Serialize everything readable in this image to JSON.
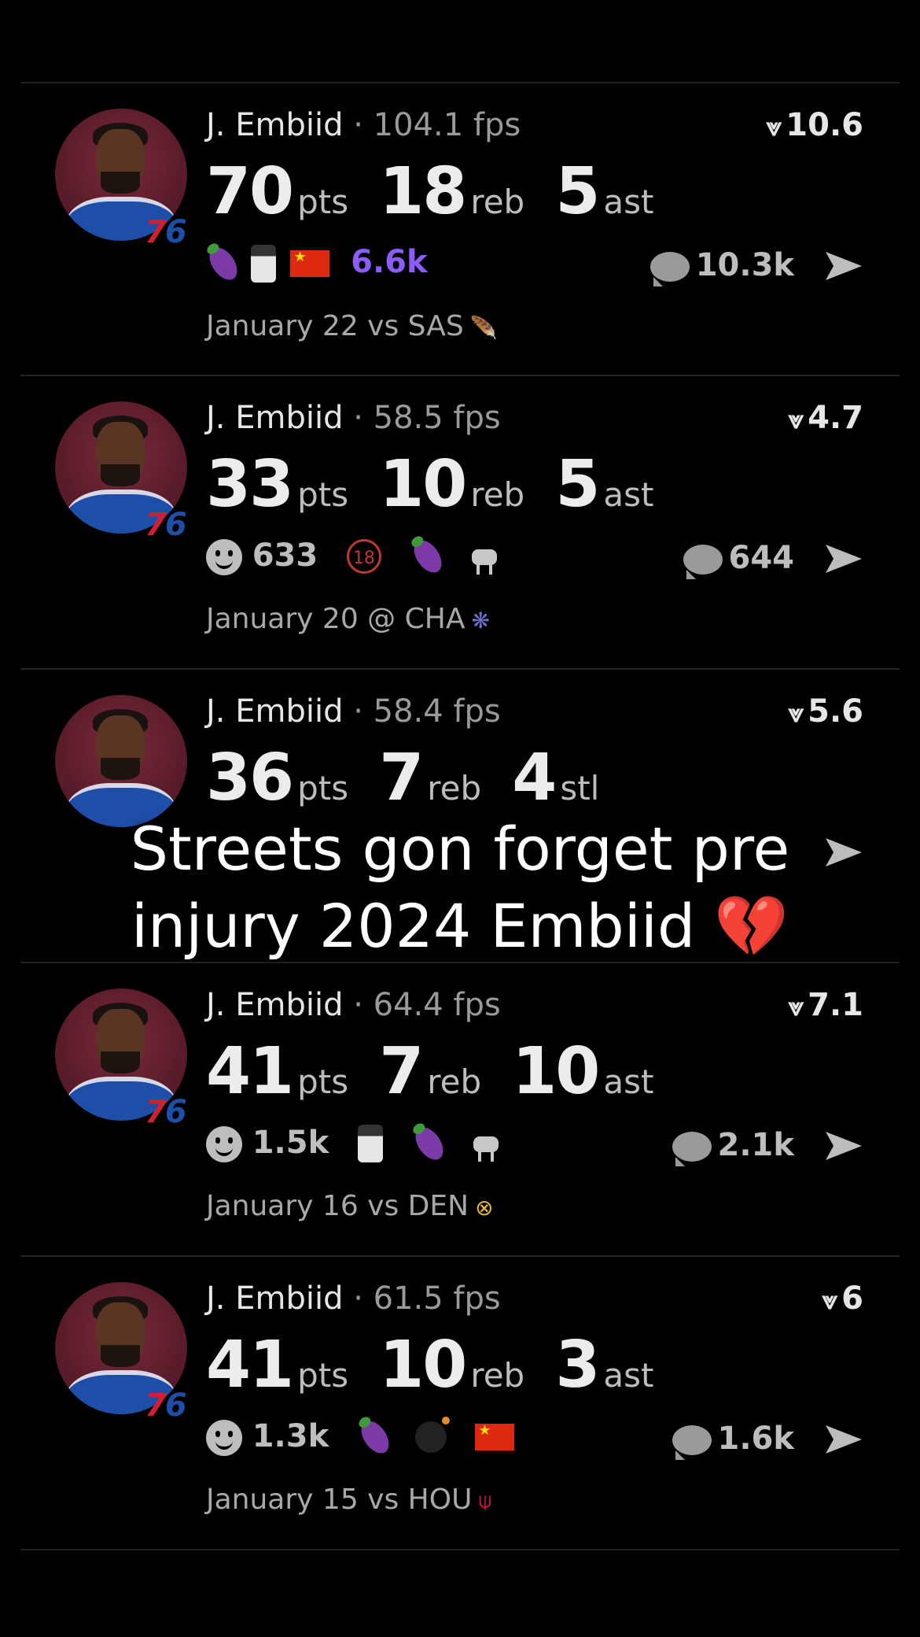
{
  "feed": [
    {
      "name": "J. Embiid",
      "fps": "104.1 fps",
      "score": "10.6",
      "stats": [
        {
          "num": "70",
          "label": "pts"
        },
        {
          "num": "18",
          "label": "reb"
        },
        {
          "num": "5",
          "label": "ast"
        }
      ],
      "reaction_count": "6.6k",
      "comments": "10.3k",
      "date": "January 22 vs SAS",
      "team_logo": "spurs-logo"
    },
    {
      "name": "J. Embiid",
      "fps": "58.5 fps",
      "score": "4.7",
      "stats": [
        {
          "num": "33",
          "label": "pts"
        },
        {
          "num": "10",
          "label": "reb"
        },
        {
          "num": "5",
          "label": "ast"
        }
      ],
      "reaction_count": "633",
      "comments": "644",
      "date": "January 20 @ CHA",
      "team_logo": "hornets-logo"
    },
    {
      "name": "J. Embiid",
      "fps": "58.4 fps",
      "score": "5.6",
      "stats": [
        {
          "num": "36",
          "label": "pts"
        },
        {
          "num": "7",
          "label": "reb"
        },
        {
          "num": "4",
          "label": "stl"
        }
      ],
      "reaction_count": "",
      "comments": "",
      "date": "",
      "team_logo": ""
    },
    {
      "name": "J. Embiid",
      "fps": "64.4 fps",
      "score": "7.1",
      "stats": [
        {
          "num": "41",
          "label": "pts"
        },
        {
          "num": "7",
          "label": "reb"
        },
        {
          "num": "10",
          "label": "ast"
        }
      ],
      "reaction_count": "1.5k",
      "comments": "2.1k",
      "date": "January 16 vs DEN",
      "team_logo": "nuggets-logo"
    },
    {
      "name": "J. Embiid",
      "fps": "61.5 fps",
      "score": "6",
      "stats": [
        {
          "num": "41",
          "label": "pts"
        },
        {
          "num": "10",
          "label": "reb"
        },
        {
          "num": "3",
          "label": "ast"
        }
      ],
      "reaction_count": "1.3k",
      "comments": "1.6k",
      "date": "January 15 vs HOU",
      "team_logo": "rockets-logo"
    }
  ],
  "overlay": {
    "line1": "Streets gon forget pre",
    "line2": "injury 2024 Embiid",
    "emoji": "💔"
  },
  "separator": "·",
  "colors": {
    "background": "#000000",
    "accent_purple": "#8b5cf6",
    "team_red": "#d0202f",
    "team_blue": "#1d4fa8"
  }
}
